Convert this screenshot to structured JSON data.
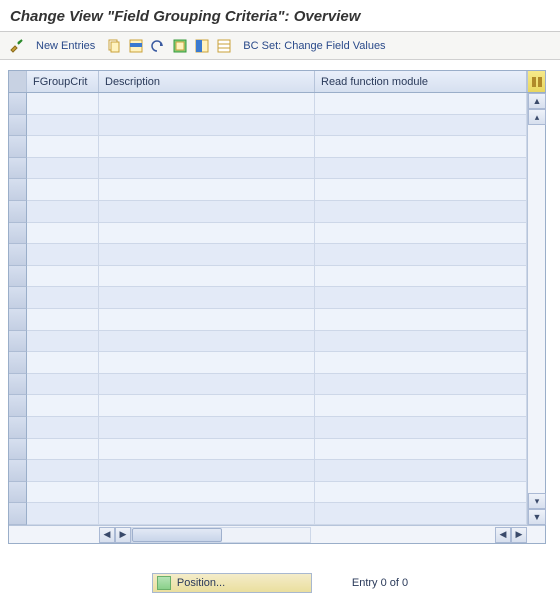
{
  "title": "Change View \"Field Grouping Criteria\": Overview",
  "toolbar": {
    "new_entries": "New Entries",
    "bc_set": "BC Set: Change Field Values"
  },
  "grid": {
    "columns": {
      "c1": "FGroupCrit",
      "c2": "Description",
      "c3": "Read function module"
    },
    "row_count": 20
  },
  "footer": {
    "position_label": "Position...",
    "entry_text": "Entry 0 of 0"
  },
  "icons": {
    "pencil": "pencil-check-icon",
    "copy": "copy-icon",
    "row": "select-row-icon",
    "undo": "undo-icon",
    "sel_all": "select-all-icon",
    "sel_block": "select-block-icon",
    "desel": "deselect-icon"
  }
}
